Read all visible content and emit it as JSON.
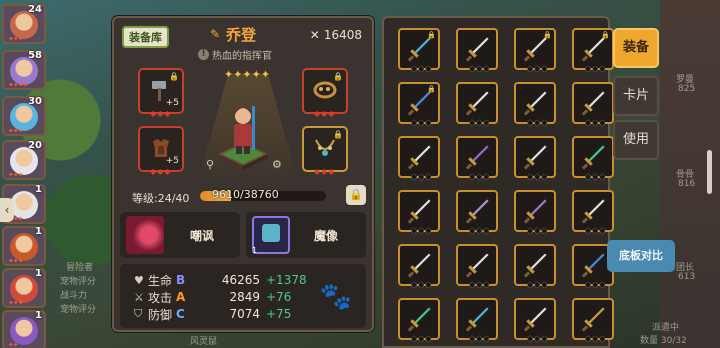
{
  "party": [
    {
      "level": "24",
      "stars": "✦✦✦",
      "face": "#c46a4a",
      "frame": "#5a4a5e"
    },
    {
      "level": "58",
      "stars": "✦✦✦✦",
      "face": "#9a7ad0",
      "frame": "#4a4a6a"
    },
    {
      "level": "30",
      "stars": "✦✦✦",
      "face": "#5ab4e0",
      "frame": "#4a5a7a"
    },
    {
      "level": "20",
      "stars": "✦✦✦",
      "face": "#e6e6ea",
      "frame": "#5a5a6a"
    },
    {
      "level": "1",
      "stars": "✦✦✦",
      "face": "#e4e4e4",
      "frame": "#6a6a6a"
    },
    {
      "level": "1",
      "stars": "✦✦✦",
      "face": "#c85a2a",
      "frame": "#6a4a3a"
    },
    {
      "level": "1",
      "stars": "✦✦✦",
      "face": "#d04a3a",
      "frame": "#6a3a3a"
    },
    {
      "level": "1",
      "stars": "✦✦",
      "face": "#8a5ac0",
      "frame": "#4a3a6a"
    }
  ],
  "hero": {
    "tag": "装备库",
    "name": "乔登",
    "title": "热血的指挥官",
    "power": "16408",
    "stars": "✦✦✦✦✦",
    "level_label": "等级:24/40",
    "exp_text": "9610/38760",
    "exp_fraction": 0.248
  },
  "equipment": [
    {
      "name": "hammer-icon",
      "plus": "+5",
      "border": "#c8402c"
    },
    {
      "name": "knuckle-icon",
      "plus": "",
      "border": "#c8402c"
    },
    {
      "name": "armor-icon",
      "plus": "+5",
      "border": "#c8402c"
    },
    {
      "name": "necklace-icon",
      "plus": "",
      "border": "#c89a3a"
    }
  ],
  "skills": [
    {
      "name": "嘲讽",
      "color": "#b02040"
    },
    {
      "name": "魔像",
      "level": "1",
      "color": "#6a5ad0"
    }
  ],
  "stats": [
    {
      "icon": "heart-icon",
      "name": "生命",
      "grade": "B",
      "grade_color": "#8a8aff",
      "value": "46265",
      "bonus": "+1378"
    },
    {
      "icon": "sword-icon",
      "name": "攻击",
      "grade": "A",
      "grade_color": "#ff9a2a",
      "value": "2849",
      "bonus": "+76"
    },
    {
      "icon": "shield-icon",
      "name": "防御",
      "grade": "C",
      "grade_color": "#6ab0ff",
      "value": "7074",
      "bonus": "+75"
    }
  ],
  "side_tabs": [
    {
      "label": "装备",
      "active": true
    },
    {
      "label": "卡片",
      "active": false
    },
    {
      "label": "使用",
      "active": false
    }
  ],
  "compare_button": "底板对比",
  "background_text": [
    "罗曼",
    "825",
    "骨骨",
    "816",
    "团长",
    "613",
    "派遣中",
    "数量 30/32",
    "冒险者",
    "宠物评分",
    "战斗力",
    "宠物评分",
    "风灵鼠"
  ],
  "inventory": [
    {
      "color": "#4ab8e0",
      "lock": true
    },
    {
      "color": "#e6e6ea",
      "lock": false
    },
    {
      "color": "#e6e6ea",
      "lock": true
    },
    {
      "color": "#e6e6ea",
      "lock": true
    },
    {
      "color": "#4a8ae0",
      "lock": true
    },
    {
      "color": "#e6e6ea",
      "lock": false
    },
    {
      "color": "#e6e6ea",
      "lock": false
    },
    {
      "color": "#e6e6ea",
      "lock": false
    },
    {
      "color": "#e6e6ea",
      "lock": false
    },
    {
      "color": "#9a6ad0",
      "lock": false
    },
    {
      "color": "#e6e6ea",
      "lock": false
    },
    {
      "color": "#3ad08a",
      "lock": false
    },
    {
      "color": "#e6e6ea",
      "lock": false
    },
    {
      "color": "#b09ad8",
      "lock": false
    },
    {
      "color": "#a07ad0",
      "lock": false
    },
    {
      "color": "#e6e6ea",
      "lock": false
    },
    {
      "color": "#e6e6ea",
      "lock": false
    },
    {
      "color": "#e6e6ea",
      "lock": false
    },
    {
      "color": "#e6e6ea",
      "lock": false
    },
    {
      "color": "#4a8ae0",
      "lock": false
    },
    {
      "color": "#3ad08a",
      "lock": false
    },
    {
      "color": "#4ab8e0",
      "lock": false
    },
    {
      "color": "#e6e6ea",
      "lock": false
    },
    {
      "color": "#d0a050",
      "lock": false
    }
  ]
}
